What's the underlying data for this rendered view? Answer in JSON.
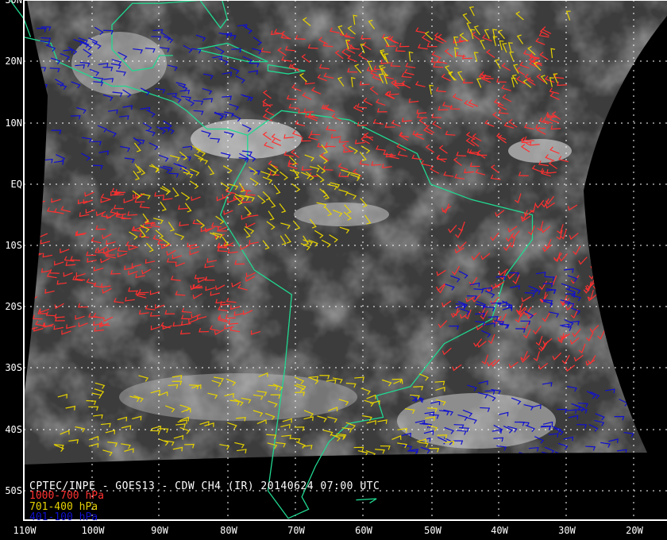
{
  "title": "CPTEC/INPE - GOES13 - CDW CH4 (IR) 20140624 07:00 UTC",
  "legend": [
    {
      "label": "1000-700 hPa",
      "color": "#ff3030"
    },
    {
      "label": "701-400 hPa",
      "color": "#e6d200"
    },
    {
      "label": "401-100 hPa",
      "color": "#1010d0"
    }
  ],
  "lon_labels": [
    "110W",
    "100W",
    "90W",
    "80W",
    "70W",
    "60W",
    "50W",
    "40W",
    "30W",
    "20W"
  ],
  "lat_labels": [
    "30N",
    "20N",
    "10N",
    "EQ",
    "10S",
    "20S",
    "30S",
    "40S",
    "50S"
  ],
  "colors": {
    "coast": "#20d890",
    "grid": "#ffffff",
    "frame": "#ffffff"
  }
}
